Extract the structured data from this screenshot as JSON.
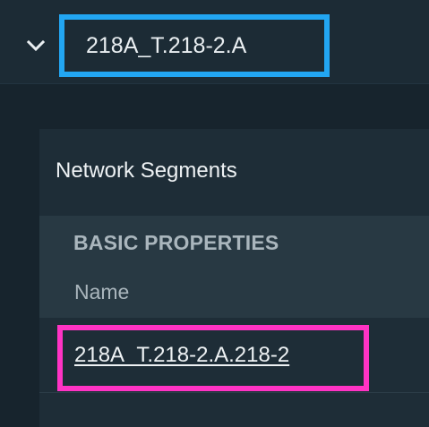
{
  "tree": {
    "node_label": "218A_T.218-2.A",
    "expand_icon": "chevron-down-icon"
  },
  "section": {
    "title": "Network Segments"
  },
  "properties": {
    "group_header": "BASIC PROPERTIES",
    "column_name": "Name",
    "rows": [
      {
        "name": "218A_T.218-2.A.218-2"
      }
    ]
  },
  "colors": {
    "highlight_blue": "#22a6f2",
    "highlight_pink": "#ff33c4",
    "background": "#17242d"
  }
}
